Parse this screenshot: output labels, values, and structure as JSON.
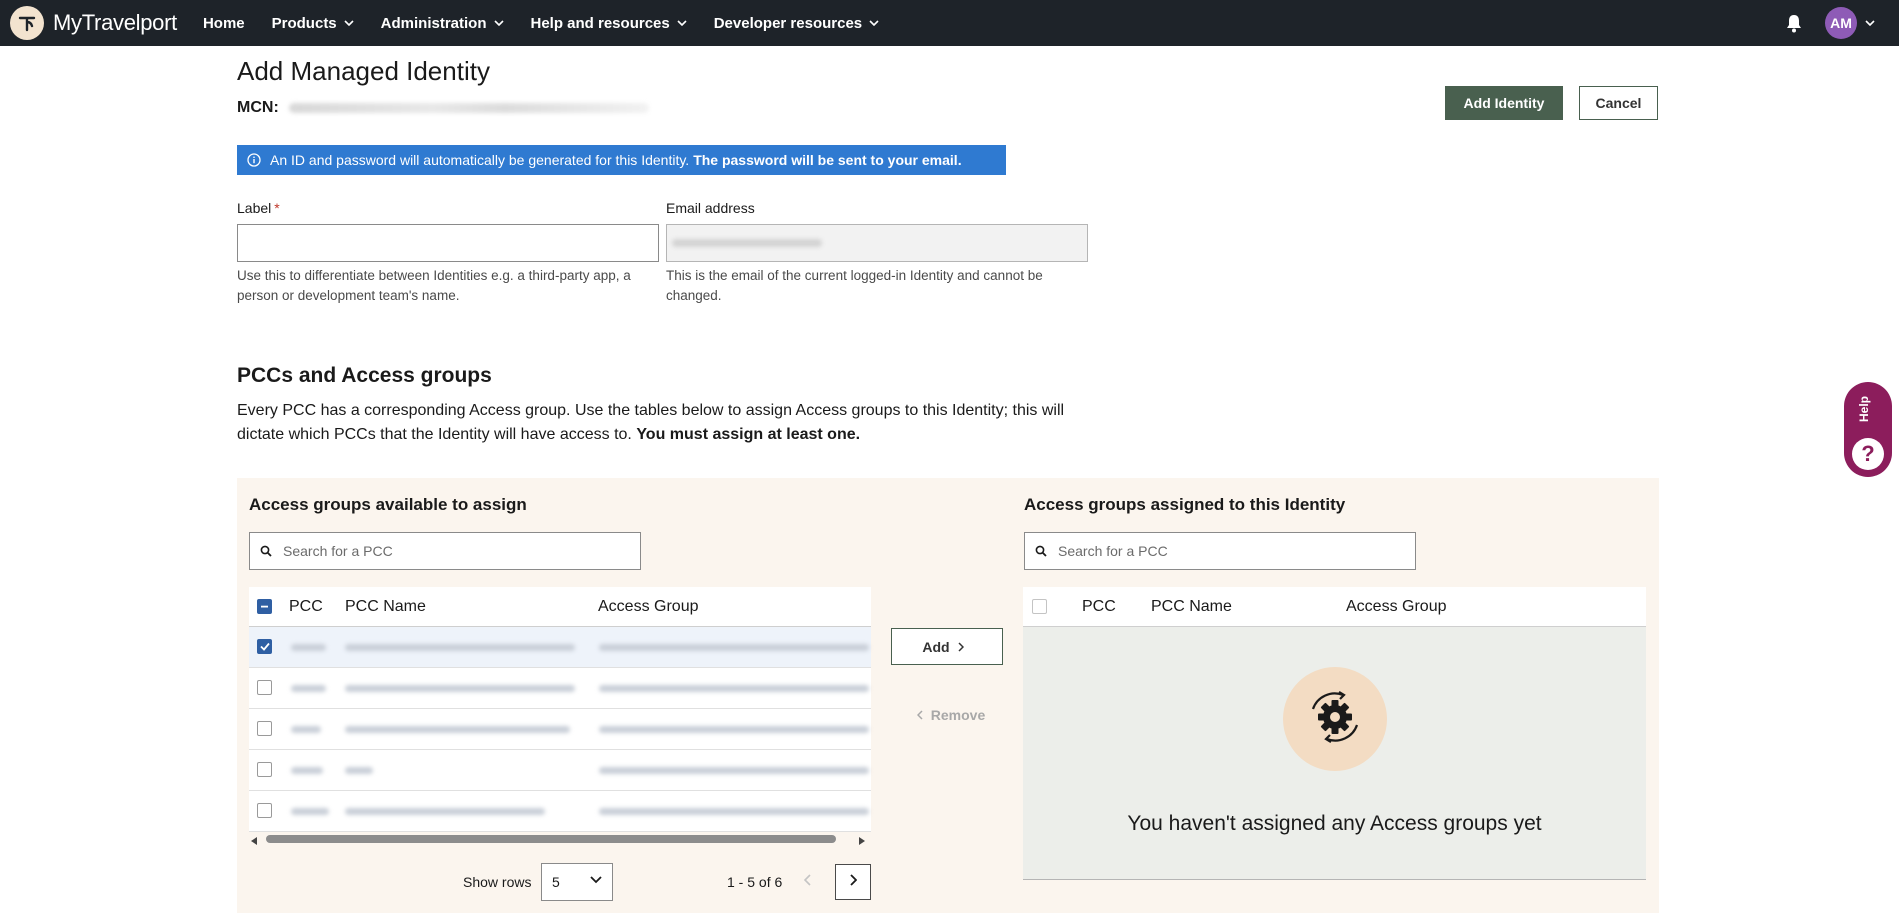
{
  "app": {
    "brand": "MyTravelport",
    "nav": [
      "Home",
      "Products",
      "Administration",
      "Help and resources",
      "Developer resources"
    ],
    "avatar_initials": "AM"
  },
  "page": {
    "title": "Add Managed Identity",
    "mcn_label": "MCN:",
    "add_identity_label": "Add Identity",
    "cancel_label": "Cancel",
    "info_text": "An ID and password will automatically be generated for this Identity.",
    "info_bold": "The password will be sent to your email."
  },
  "form": {
    "label_field": {
      "label": "Label",
      "required_mark": "*",
      "value": "",
      "help": "Use this to differentiate between Identities e.g. a third-party app, a person or development team's name."
    },
    "email_field": {
      "label": "Email address",
      "help": "This is the email of the current logged-in Identity and cannot be changed."
    }
  },
  "pcc_section": {
    "title": "PCCs and Access groups",
    "description": "Every PCC has a corresponding Access group. Use the tables below to assign Access groups to this Identity; this will dictate which PCCs that the Identity will have access to.",
    "description_bold": "You must assign at least one."
  },
  "available": {
    "title": "Access groups available to assign",
    "search_placeholder": "Search for a PCC",
    "columns": [
      "PCC",
      "PCC Name",
      "Access Group"
    ],
    "rows_selected": [
      true,
      false,
      false,
      false,
      false
    ],
    "show_rows_label": "Show rows",
    "show_rows_value": "5",
    "page_info": "1 - 5 of 6"
  },
  "actions": {
    "add_label": "Add",
    "remove_label": "Remove"
  },
  "assigned": {
    "title": "Access groups assigned to this Identity",
    "search_placeholder": "Search for a PCC",
    "columns": [
      "PCC",
      "PCC Name",
      "Access Group"
    ],
    "empty_text": "You haven't assigned any Access groups yet"
  },
  "help_tab": {
    "label": "Help",
    "icon": "?"
  },
  "colors": {
    "nav_bg": "#1e2329",
    "primary_button": "#49604f",
    "info_banner": "#2f7ad1",
    "panel_bg": "#fbf5ee",
    "help_tab": "#8c1d5c"
  }
}
